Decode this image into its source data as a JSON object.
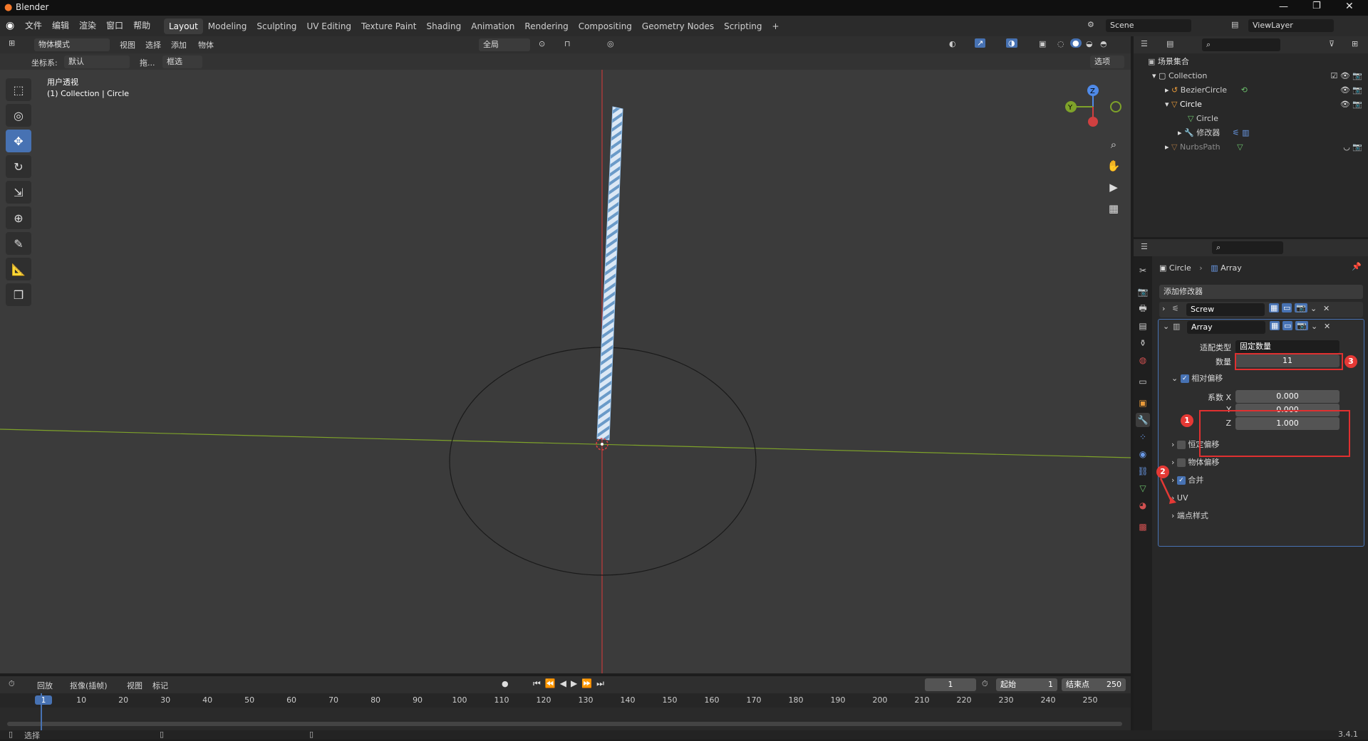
{
  "app": {
    "title": "Blender",
    "version": "3.4.1"
  },
  "menu": [
    "文件",
    "编辑",
    "渲染",
    "窗口",
    "帮助"
  ],
  "workspaces": [
    "Layout",
    "Modeling",
    "Sculpting",
    "UV Editing",
    "Texture Paint",
    "Shading",
    "Animation",
    "Rendering",
    "Compositing",
    "Geometry Nodes",
    "Scripting"
  ],
  "active_workspace": "Layout",
  "scene": "Scene",
  "viewlayer": "ViewLayer",
  "header": {
    "mode": "物体模式",
    "menus": [
      "视图",
      "选择",
      "添加",
      "物体"
    ],
    "transform_orientation": "全局",
    "options": "选项"
  },
  "subheader": {
    "coord_label": "坐标系:",
    "coord_value": "默认",
    "drag_label": "拖...",
    "drag_value": "框选"
  },
  "viewport": {
    "view_name": "用户透视",
    "collection_info": "(1) Collection | Circle"
  },
  "outliner": {
    "root": "场景集合",
    "items": [
      {
        "label": "Collection",
        "color": "#cfcfcf"
      },
      {
        "label": "BezierCircle",
        "color": "#cfcfcf"
      },
      {
        "label": "Circle",
        "color": "#ffffff"
      },
      {
        "label": "Circle",
        "color": "#cfcfcf"
      },
      {
        "label": "修改器",
        "color": "#cfcfcf"
      },
      {
        "label": "NurbsPath",
        "color": "#8a8a8a"
      }
    ]
  },
  "properties": {
    "breadcrumb_object": "Circle",
    "breadcrumb_modifier": "Array",
    "add_modifier": "添加修改器",
    "screw_name": "Screw",
    "array_name": "Array",
    "fit_type_label": "适配类型",
    "fit_type_value": "固定数量",
    "count_label": "数量",
    "count_value": "11",
    "relative_offset_label": "相对偏移",
    "factor_x_label": "系数 X",
    "factor_x": "0.000",
    "y_label": "Y",
    "factor_y": "0.000",
    "z_label": "Z",
    "factor_z": "1.000",
    "subpanels": [
      "恒定偏移",
      "物体偏移",
      "合并",
      "UV",
      "端点样式"
    ]
  },
  "annotations": [
    "1",
    "2",
    "3"
  ],
  "timeline": {
    "menus": [
      "回放",
      "抠像(插帧)",
      "视图",
      "标记"
    ],
    "current_frame": "1",
    "start_label": "起始",
    "start": "1",
    "end_label": "结束点",
    "end": "250",
    "ticks": [
      "1",
      "10",
      "20",
      "30",
      "40",
      "50",
      "60",
      "70",
      "80",
      "90",
      "100",
      "110",
      "120",
      "130",
      "140",
      "150",
      "160",
      "170",
      "180",
      "190",
      "200",
      "210",
      "220",
      "230",
      "240",
      "250"
    ]
  },
  "status": {
    "select": "选择"
  }
}
